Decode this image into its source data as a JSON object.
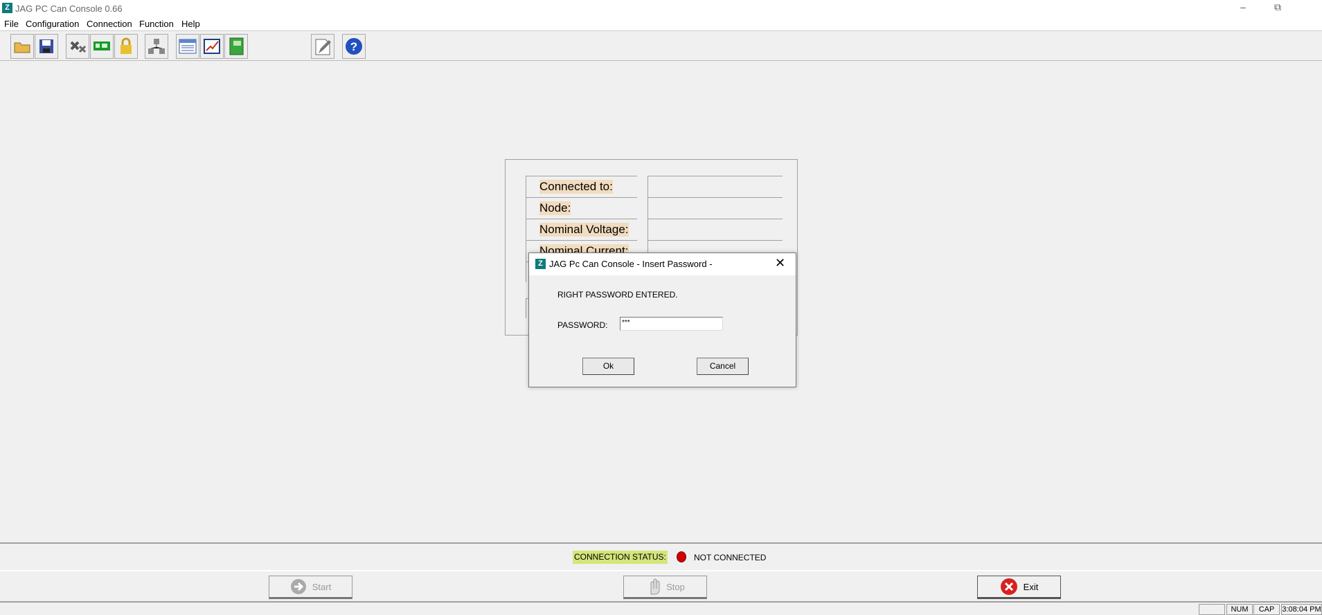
{
  "window": {
    "title": "JAG PC Can Console 0.66",
    "icon": "jag-logo-icon"
  },
  "menu": [
    "File",
    "Configuration",
    "Connection",
    "Function",
    "Help"
  ],
  "toolbar": [
    "open-folder-icon",
    "save-icon",
    "disconnect-icon",
    "can-board-icon",
    "lock-icon",
    "network-icon",
    "window-icon",
    "chart-icon",
    "notebook-icon",
    "edit-icon",
    "help-icon"
  ],
  "panel": {
    "labels": [
      "Connected to:",
      "Node:",
      "Nominal Voltage:",
      "Nominal Current:"
    ]
  },
  "dialog": {
    "title": "JAG Pc Can Console - Insert Password -",
    "message": "RIGHT PASSWORD ENTERED.",
    "password_label": "PASSWORD:",
    "password_value": "***",
    "ok": "Ok",
    "cancel": "Cancel"
  },
  "connection": {
    "label": "CONNECTION STATUS:",
    "status": "NOT CONNECTED",
    "color": "#d00000"
  },
  "buttons": {
    "start": "Start",
    "stop": "Stop",
    "exit": "Exit"
  },
  "statusbar": {
    "num": "NUM",
    "cap": "CAP",
    "time": "3:08:04 PM"
  }
}
